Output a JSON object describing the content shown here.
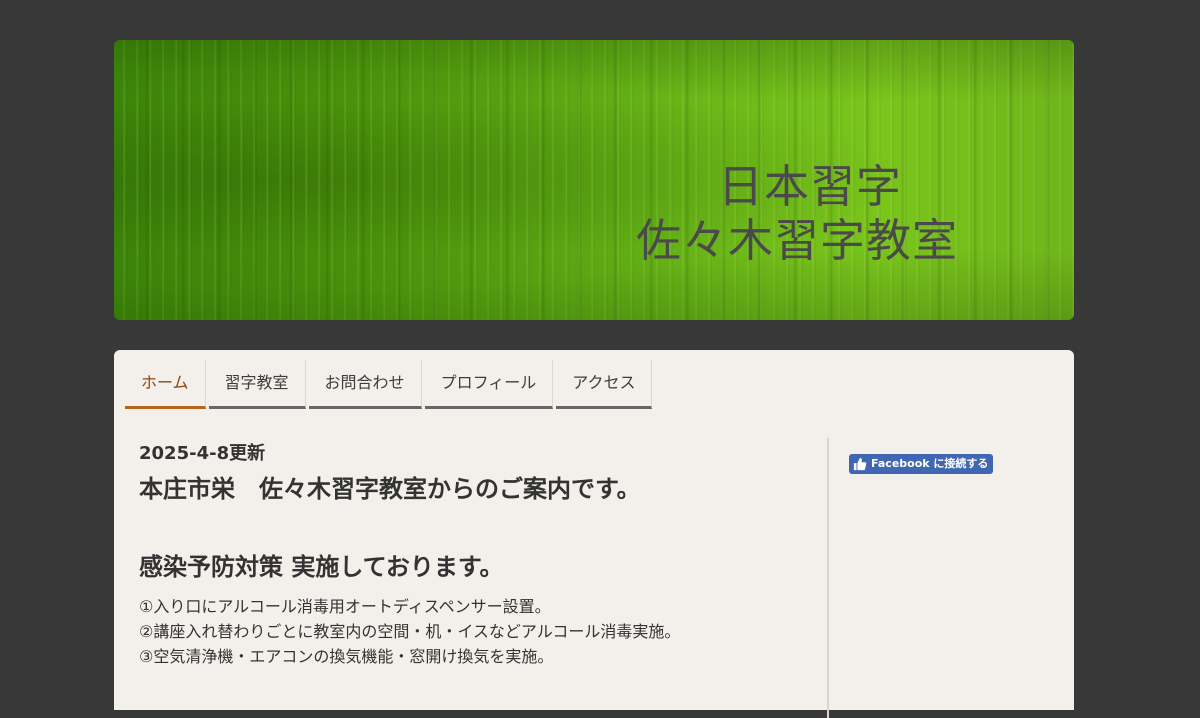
{
  "header": {
    "title_line1": "日本習字",
    "title_line2": "佐々木習字教室"
  },
  "nav": {
    "items": [
      {
        "label": "ホーム",
        "active": true
      },
      {
        "label": "習字教室",
        "active": false
      },
      {
        "label": "お問合わせ",
        "active": false
      },
      {
        "label": "プロフィール",
        "active": false
      },
      {
        "label": "アクセス",
        "active": false
      }
    ]
  },
  "content": {
    "updated": "2025-4-8更新",
    "intro": "本庄市栄　佐々木習字教室からのご案内です。",
    "heading": "感染予防対策 実施しております。",
    "lines": [
      "①入り口にアルコール消毒用オートディスペンサー設置。",
      "②講座入れ替わりごとに教室内の空間・机・イスなどアルコール消毒実施。",
      "③空気清浄機・エアコンの換気機能・窓開け換気を実施。"
    ]
  },
  "sidebar": {
    "facebook_label": "Facebook に接続する",
    "facebook_icon": "thumbs-up-icon"
  },
  "colors": {
    "background": "#383838",
    "panel": "#f3efea",
    "nav_active": "#b5651d",
    "facebook": "#4267b2"
  }
}
